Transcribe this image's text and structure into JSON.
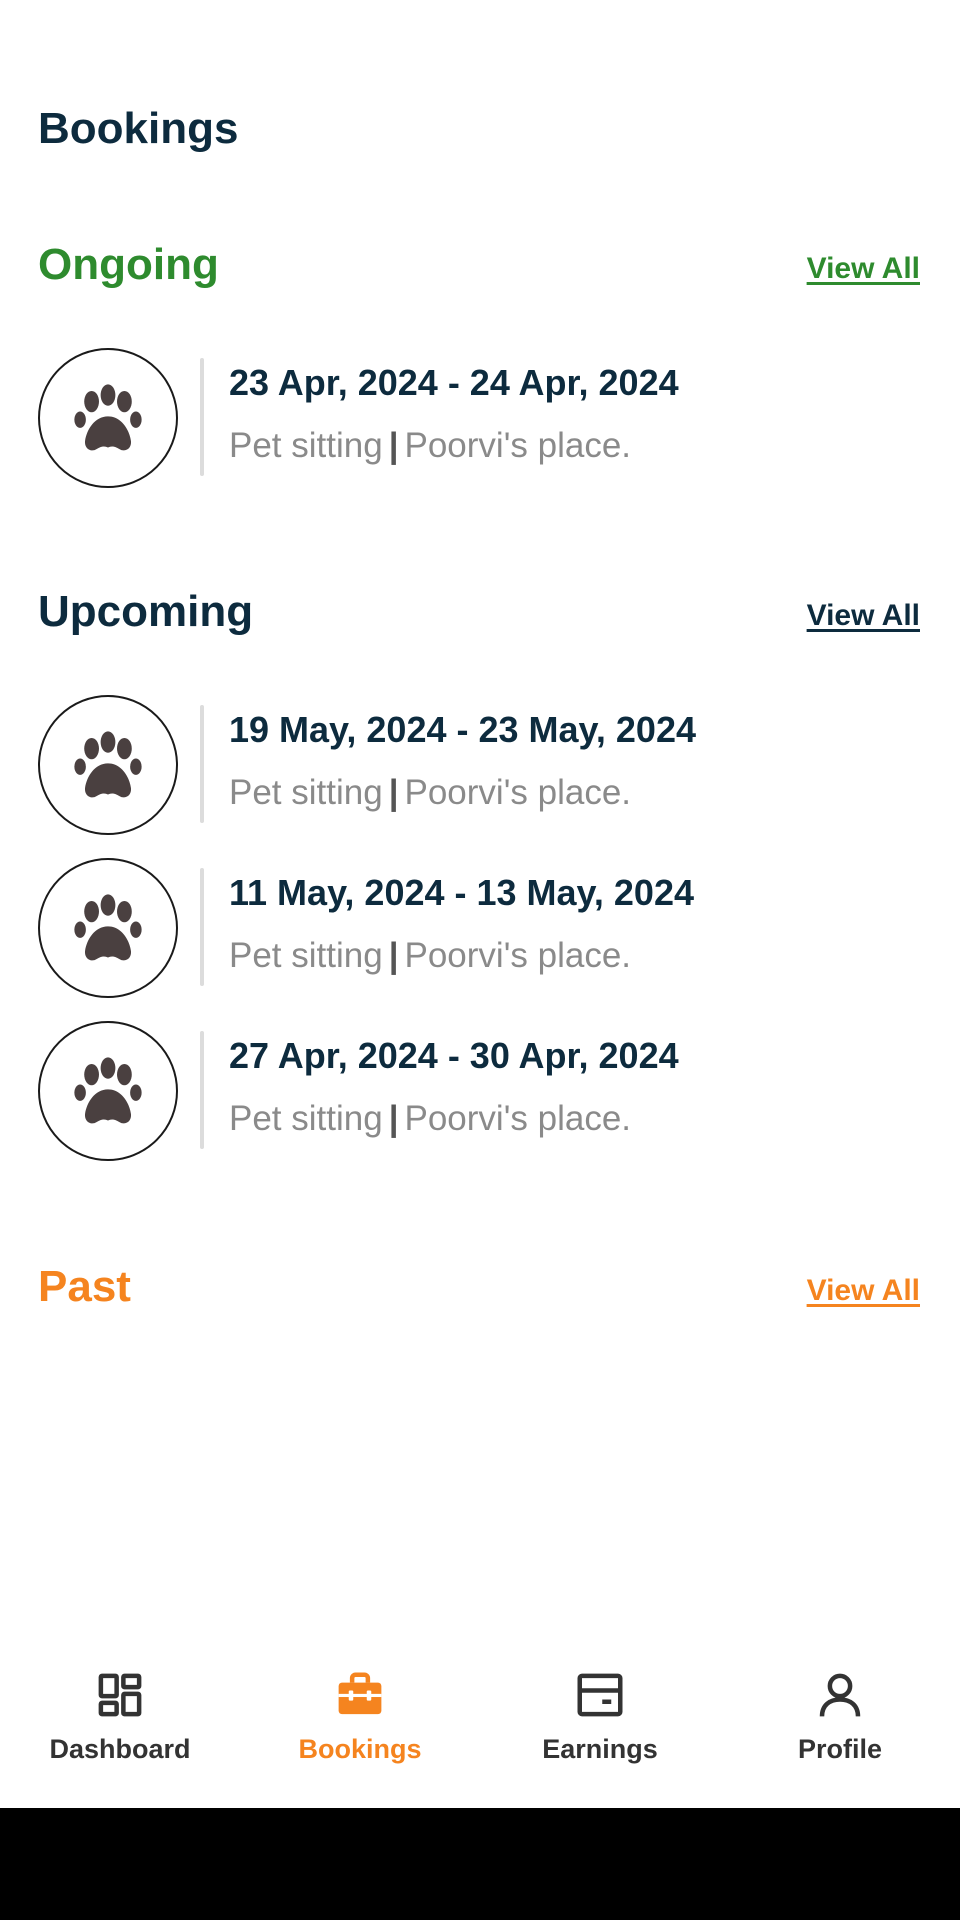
{
  "page": {
    "title": "Bookings"
  },
  "colors": {
    "ongoing": "#2e8b2e",
    "upcoming": "#0d2b3e",
    "past": "#f5841f",
    "nav_active": "#f5841f",
    "nav_inactive": "#333333"
  },
  "sections": {
    "ongoing": {
      "title": "Ongoing",
      "view_all": "View All",
      "bookings": [
        {
          "dates": "23 Apr, 2024 - 24 Apr, 2024",
          "service": "Pet sitting",
          "separator": "|",
          "place": "Poorvi's place.",
          "icon": "paw-icon"
        }
      ]
    },
    "upcoming": {
      "title": "Upcoming",
      "view_all": "View All",
      "bookings": [
        {
          "dates": "19 May, 2024 - 23 May, 2024",
          "service": "Pet sitting",
          "separator": "|",
          "place": "Poorvi's place.",
          "icon": "paw-icon"
        },
        {
          "dates": "11 May, 2024 - 13 May, 2024",
          "service": "Pet sitting",
          "separator": "|",
          "place": "Poorvi's place.",
          "icon": "paw-icon"
        },
        {
          "dates": "27 Apr, 2024 - 30 Apr, 2024",
          "service": "Pet sitting",
          "separator": "|",
          "place": "Poorvi's place.",
          "icon": "paw-icon"
        }
      ]
    },
    "past": {
      "title": "Past",
      "view_all": "View All",
      "bookings": []
    }
  },
  "bottom_nav": {
    "active": "Bookings",
    "items": [
      {
        "label": "Dashboard",
        "icon": "dashboard-icon"
      },
      {
        "label": "Bookings",
        "icon": "briefcase-icon"
      },
      {
        "label": "Earnings",
        "icon": "wallet-icon"
      },
      {
        "label": "Profile",
        "icon": "person-icon"
      }
    ]
  }
}
